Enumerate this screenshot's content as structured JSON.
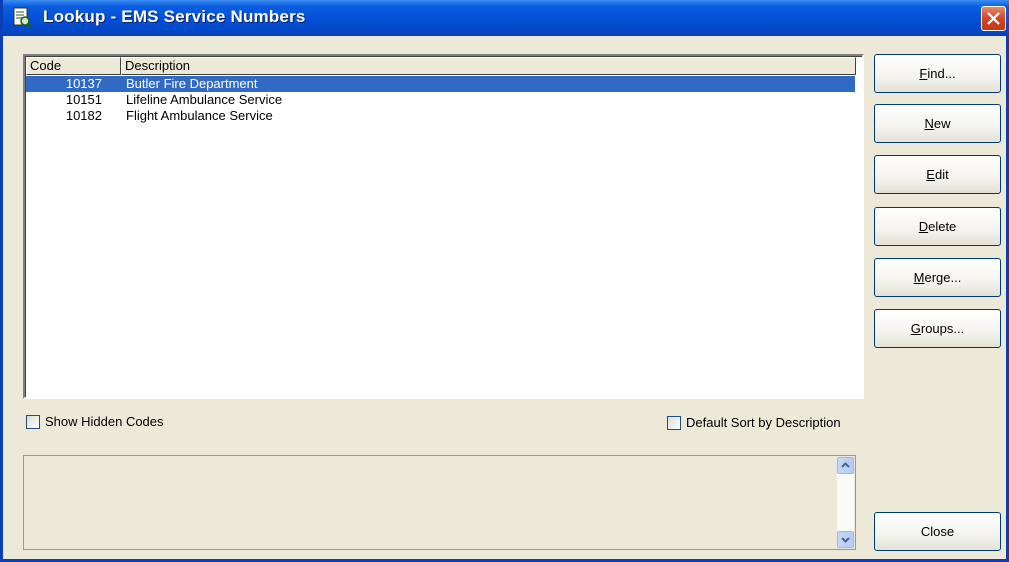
{
  "window": {
    "title": "Lookup - EMS Service Numbers"
  },
  "icons": {
    "app": "lookup-document-icon",
    "close": "close-icon",
    "scroll_up": "scroll-up-arrow-icon",
    "scroll_down": "scroll-down-arrow-icon"
  },
  "list": {
    "columns": [
      "Code",
      "Description"
    ],
    "rows": [
      {
        "code": "10137",
        "description": "Butler Fire Department",
        "selected": true
      },
      {
        "code": "10151",
        "description": "Lifeline Ambulance Service",
        "selected": false
      },
      {
        "code": "10182",
        "description": "Flight Ambulance Service",
        "selected": false
      }
    ]
  },
  "buttons": {
    "find": {
      "mnemonic": "F",
      "rest": "ind..."
    },
    "new": {
      "mnemonic": "N",
      "rest": "ew"
    },
    "edit": {
      "mnemonic": "E",
      "rest": "dit"
    },
    "delete": {
      "mnemonic": "D",
      "rest": "elete"
    },
    "merge": {
      "mnemonic": "M",
      "rest": "erge..."
    },
    "groups": {
      "mnemonic": "G",
      "rest": "roups..."
    },
    "close": "Close"
  },
  "options": {
    "show_hidden_codes": {
      "label": "Show Hidden Codes",
      "checked": false
    },
    "default_sort_by_description": {
      "label": "Default Sort by Description",
      "checked": false
    }
  },
  "memo": {
    "text": ""
  },
  "colors": {
    "title_bar": "#0450d8",
    "selection": "#316ac5",
    "dialog_bg": "#ece9d8"
  }
}
